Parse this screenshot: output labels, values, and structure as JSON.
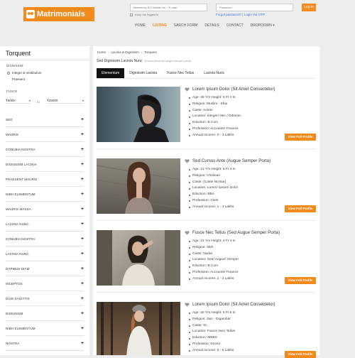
{
  "brand": {
    "name": "Matrimonials",
    "accent": "#f28a1c"
  },
  "login": {
    "user_placeholder": "Matrimony ID / Mobile No. / E-mail",
    "pass_placeholder": "Password",
    "button": "Log in",
    "keep_label": "Keep me logged in",
    "forgot": "Forgot password?  |  Login Via OTP"
  },
  "nav": {
    "items": [
      "HOME",
      "LISTING",
      "SARCH FORM",
      "DETAILS",
      "CONTACT",
      "DROPDOWN ▾"
    ]
  },
  "sidebar": {
    "title": "Torquent",
    "dignissim_label": "DIGNISSIM",
    "opt1": "Integer & Vestibulum",
    "opt2": "Praesent",
    "fusce_label": "FUSCE",
    "from": "₹5000",
    "to_label": "to",
    "to": "₹25000",
    "sections": [
      "SED",
      "MAURIS",
      "CONUBIA NOSTRA",
      "DIGNISSIM LACINIA",
      "PRAESENT MAURIS",
      "NIBH ELEMENTUM",
      "MAURIS MASSA",
      "LACINIA NUNC",
      "CONUBIA NOSTRA",
      "LACINIA NUNC",
      "DAPIBUS DIAM",
      "INCEPTOS",
      "DUIS SAGITTIS",
      "DIGNISSIM",
      "NIBH ELEMENTUM",
      "NOSTRA"
    ]
  },
  "breadcrumb": {
    "home": "Home",
    "mid": "Lacinia & Dignissim",
    "current": "Torquent"
  },
  "main": {
    "title": "Sed Dignissim Lacinia Nunc",
    "subtitle": "(Fusce tellus sed augue semper porta)",
    "tabs": [
      "Elementum",
      "Dignissim Lacinia",
      "Fusce Nec Tellus",
      "Lacinia Nunc"
    ],
    "view_label": "View Full Profile"
  },
  "profiles": [
    {
      "name": "Lorem Ipsum Dolor (Sit Amet Consectetur)",
      "details": [
        "Age: 28 Yrs Height: 5 Ft 4 In",
        "Religion: Muslim - Shia",
        "Caste: Ansari",
        "Location: Integer/ Nec / Odionec",
        "Eduction: B.Com",
        "Profession: Accounts/ Finance",
        "Annual Income: 2 - 3 Lakhs"
      ]
    },
    {
      "name": "Sed Cursus Ante (Augue Semper Porta)",
      "details": [
        "Age: 21 Yrs Height: 6 Ft 4 In",
        "Religion: Christian",
        "Caste: (Caste No Bar)",
        "Location: Lorem/ Ipsum/ Dolor",
        "Eduction: BBA",
        "Profession: Clerk",
        "Annual Income: 1 - 4 Lakhs"
      ]
    },
    {
      "name": "Fusce Nec Tellus (Sed Augue Semper Porta)",
      "details": [
        "Age: 24 Yrs Height: 4 Ft 4 In",
        "Religion: Sikh",
        "Caste: Nadar",
        "Location: Sed/ Augue/ Semper",
        "Eduction: B.Com",
        "Profession: Accounts/ Finance",
        "Annual Income: 2 - 3 Lakhs"
      ]
    },
    {
      "name": "Lorem Ipsum Dolor (Sit Amet Consectetur)",
      "details": [
        "Age: 25 Yrs Height: 5 Ft 6 In",
        "Religion: Jain - Digambar",
        "Caste: Sc",
        "Location: Fusce/ Nec/ Tellus",
        "Eduction: MBBS",
        "Profession: Doctor",
        "Annual Income: 5 - 6 Lakhs"
      ]
    }
  ]
}
